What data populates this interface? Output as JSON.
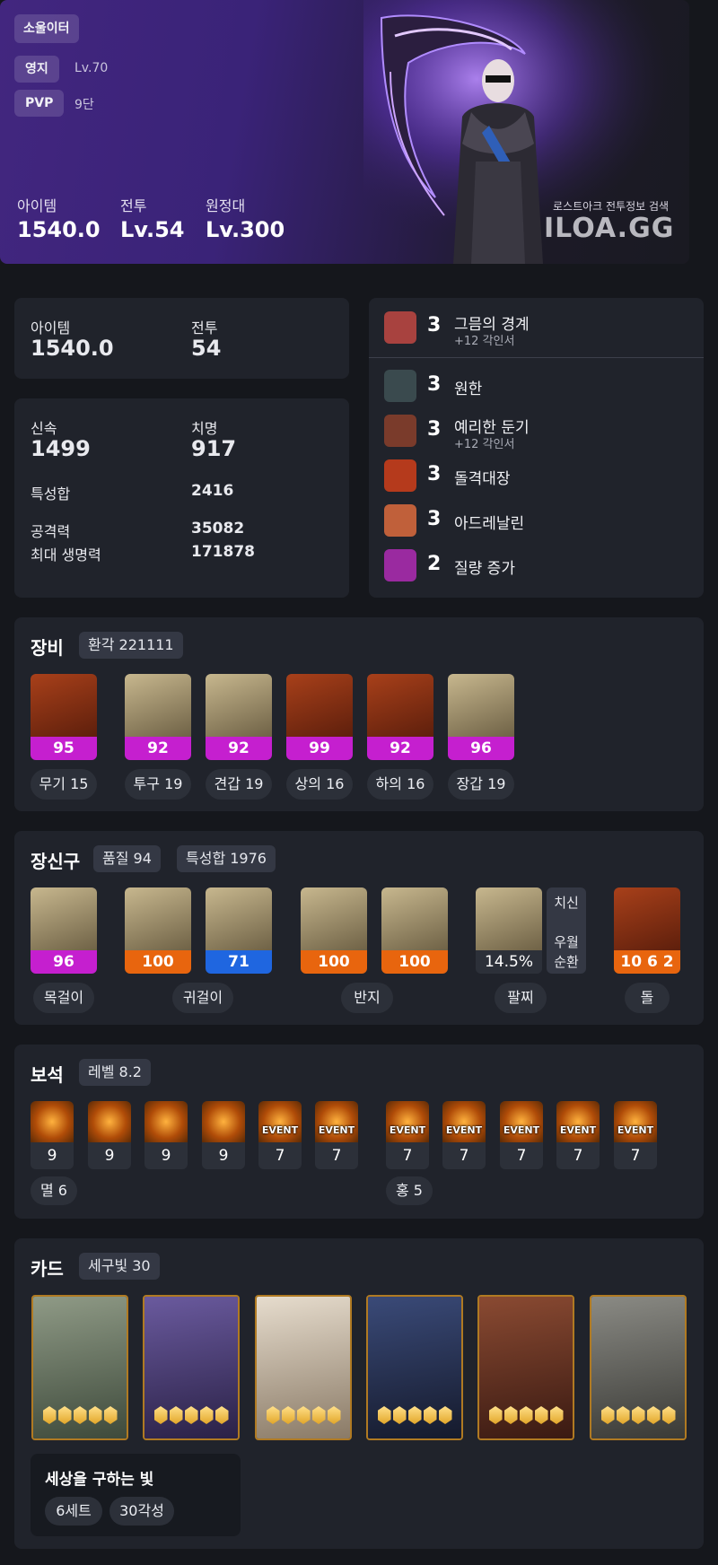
{
  "hero": {
    "class_name": "소울이터",
    "estate_label": "영지",
    "estate_value": "Lv.70",
    "pvp_label": "PVP",
    "pvp_value": "9단",
    "stats": [
      {
        "label": "아이템",
        "value": "1540.0"
      },
      {
        "label": "전투",
        "value": "Lv.54"
      },
      {
        "label": "원정대",
        "value": "Lv.300"
      }
    ],
    "watermark_caption": "로스트아크 전투정보 검색",
    "watermark_logo": "ILOA.GG"
  },
  "summary": {
    "item_label": "아이템",
    "item_value": "1540.0",
    "combat_label": "전투",
    "combat_value": "54"
  },
  "stats": {
    "swiftness_label": "신속",
    "swiftness_value": "1499",
    "crit_label": "치명",
    "crit_value": "917",
    "total_label": "특성합",
    "total_value": "2416",
    "attack_label": "공격력",
    "attack_value": "35082",
    "hp_label": "최대 생명력",
    "hp_value": "171878"
  },
  "engravings": [
    {
      "level": "3",
      "name": "그믐의 경계",
      "sub": "+12 각인서",
      "icon": "reaper-icon",
      "color": "#a8423f"
    },
    {
      "level": "3",
      "name": "원한",
      "sub": "",
      "icon": "grudge-icon",
      "color": "#3a4a4e"
    },
    {
      "level": "3",
      "name": "예리한 둔기",
      "sub": "+12 각인서",
      "icon": "blunt-icon",
      "color": "#7a3b2b"
    },
    {
      "level": "3",
      "name": "돌격대장",
      "sub": "",
      "icon": "raid-captain-icon",
      "color": "#b53a1c"
    },
    {
      "level": "3",
      "name": "아드레날린",
      "sub": "",
      "icon": "adrenaline-icon",
      "color": "#c0603a"
    },
    {
      "level": "2",
      "name": "질량 증가",
      "sub": "",
      "icon": "mass-increase-icon",
      "color": "#9a2aa0"
    }
  ],
  "equipment": {
    "title": "장비",
    "badge": "환각 221111",
    "items": [
      {
        "quality": "95",
        "label": "무기 15",
        "icon": "weapon-scythe-icon",
        "bg": "#7a2a12"
      },
      {
        "quality": "92",
        "label": "투구 19",
        "icon": "helmet-icon",
        "bg": "#8a7a55"
      },
      {
        "quality": "92",
        "label": "견갑 19",
        "icon": "shoulder-icon",
        "bg": "#8a7a55"
      },
      {
        "quality": "99",
        "label": "상의 16",
        "icon": "chest-armor-icon",
        "bg": "#7a2a12"
      },
      {
        "quality": "92",
        "label": "하의 16",
        "icon": "leg-armor-icon",
        "bg": "#7a2a12"
      },
      {
        "quality": "96",
        "label": "장갑 19",
        "icon": "gloves-icon",
        "bg": "#8a7a55"
      }
    ],
    "quality_color": "#c51fcf"
  },
  "accessories": {
    "title": "장신구",
    "quality_badge": "품질 94",
    "stat_badge": "특성합 1976",
    "items": [
      {
        "quality": "96",
        "icon": "necklace-icon",
        "bar": "#c51fcf"
      },
      {
        "quality": "100",
        "icon": "earring-icon",
        "bar": "#e8650e"
      },
      {
        "quality": "71",
        "icon": "earring-icon",
        "bar": "#1f66e0"
      },
      {
        "quality": "100",
        "icon": "ring-icon",
        "bar": "#e8650e"
      },
      {
        "quality": "100",
        "icon": "ring-icon",
        "bar": "#e8650e"
      }
    ],
    "bracelet_value": "14.5%",
    "bracelet_stats": [
      "치신",
      "우월",
      "순환"
    ],
    "stone_value": "10 6 2",
    "labels": {
      "necklace": "목걸이",
      "earring": "귀걸이",
      "ring": "반지",
      "bracelet": "팔찌",
      "stone": "돌"
    }
  },
  "gems": {
    "title": "보석",
    "badge": "레벨 8.2",
    "event_label": "EVENT",
    "left": [
      {
        "level": "9",
        "event": false
      },
      {
        "level": "9",
        "event": false
      },
      {
        "level": "9",
        "event": false
      },
      {
        "level": "9",
        "event": false
      },
      {
        "level": "7",
        "event": true
      },
      {
        "level": "7",
        "event": true
      }
    ],
    "right": [
      {
        "level": "7",
        "event": true
      },
      {
        "level": "7",
        "event": true
      },
      {
        "level": "7",
        "event": true
      },
      {
        "level": "7",
        "event": true
      },
      {
        "level": "7",
        "event": true
      }
    ],
    "left_label": "멸 6",
    "right_label": "홍 5"
  },
  "cards": {
    "title": "카드",
    "badge": "세구빛 30",
    "awakening_per_card": 5,
    "set_name": "세상을 구하는 빛",
    "set_count": "6세트",
    "set_awakening": "30각성",
    "palette": [
      "#6c7a6a",
      "#4a3d6e",
      "#c9b8a4",
      "#2b3550",
      "#6a3a2a",
      "#6b6a66"
    ]
  }
}
